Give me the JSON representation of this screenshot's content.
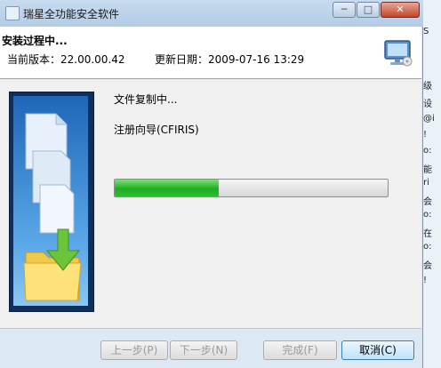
{
  "window": {
    "title": "瑞星全功能安全软件",
    "controls": {
      "minimize": "─",
      "maximize": "□",
      "close": "✕"
    }
  },
  "header": {
    "title": "安装过程中...",
    "version": "当前版本：22.00.00.42",
    "update_date": "更新日期：2009-07-16 13:29"
  },
  "content": {
    "status_line1": "文件复制中...",
    "status_line2": "注册向导(CFIRIS)",
    "progress_fraction": 0.38
  },
  "buttons": {
    "prev": "上一步(P)",
    "next": "下一步(N)",
    "finish": "完成(F)",
    "cancel": "取消(C)"
  },
  "background_window": {
    "fragments": [
      "S",
      "级",
      "设",
      "@i",
      "!",
      "o:",
      "能",
      "ri",
      "会",
      "o:",
      "在",
      "o:",
      "会",
      "!"
    ]
  },
  "colors": {
    "progress_green": "#1fae22",
    "accent": "#3c7fb1"
  }
}
